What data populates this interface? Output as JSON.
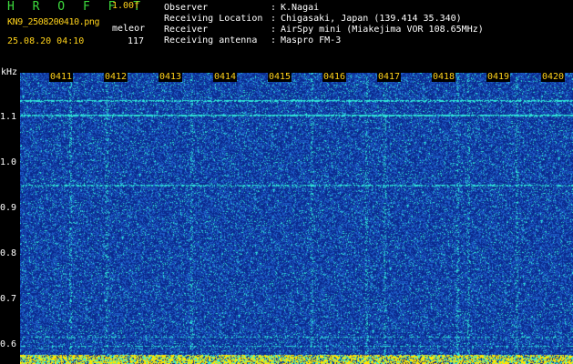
{
  "header": {
    "app_title": "H R O F F T",
    "app_version": "1.00f",
    "file_name": "KN9_2508200410.png",
    "mode_label": "meleor",
    "timestamp": "25.08.20 04:10",
    "count": "117"
  },
  "info": [
    {
      "label": "Observer",
      "value": "K.Nagai"
    },
    {
      "label": "Receiving Location",
      "value": "Chigasaki, Japan (139.414 35.340)"
    },
    {
      "label": "Receiver",
      "value": "AirSpy mini (Miakejima VOR 108.65MHz)"
    },
    {
      "label": "Receiving antenna",
      "value": "Maspro FM-3"
    }
  ],
  "spectrogram": {
    "unit": "kHz",
    "frequency_ticks": [
      "1.1",
      "1.0",
      "0.9",
      "0.8",
      "0.7",
      "0.6"
    ],
    "time_labels": [
      "0411",
      "0412",
      "0413",
      "0414",
      "0415",
      "0416",
      "0417",
      "0418",
      "0419",
      "0420"
    ],
    "colors": {
      "background": "#0b2a8e",
      "noise": "#1e5ec8",
      "signal": "#2ee6d8",
      "baseline": "#ffe600"
    }
  }
}
